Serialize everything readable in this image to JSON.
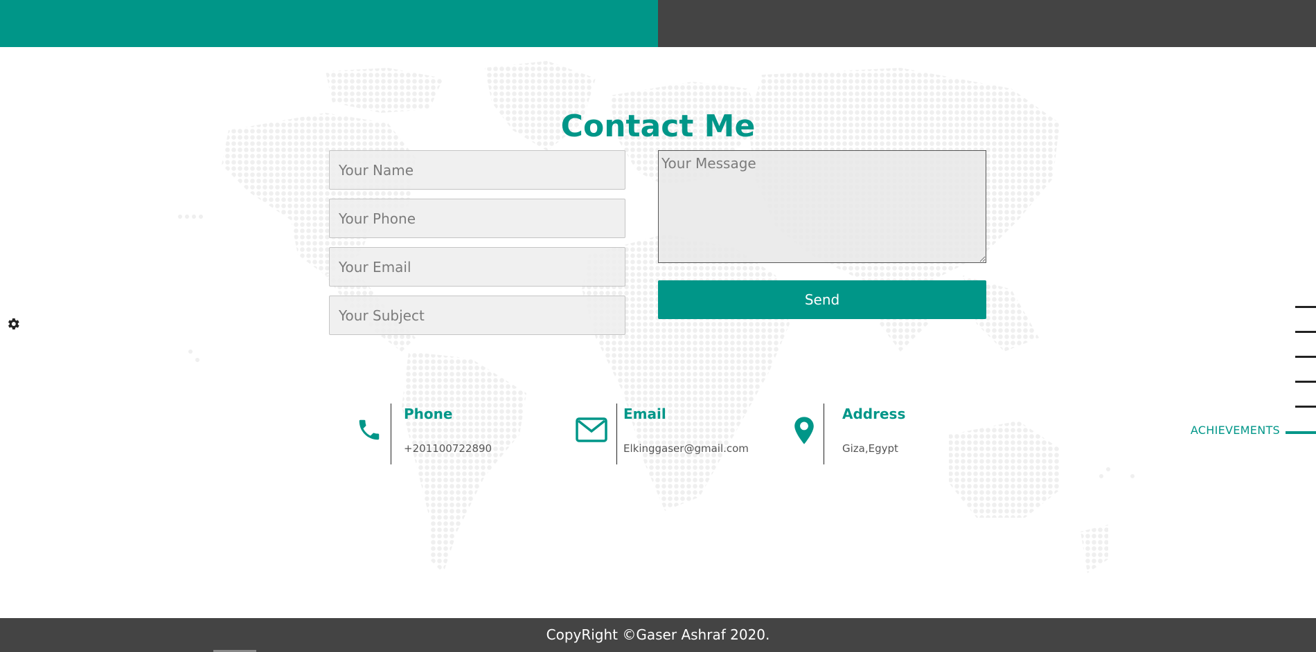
{
  "contact": {
    "title": "Contact Me",
    "form": {
      "name_placeholder": "Your Name",
      "phone_placeholder": "Your Phone",
      "email_placeholder": "Your Email",
      "subject_placeholder": "Your Subject",
      "message_placeholder": "Your Message",
      "send_label": "Send"
    },
    "info": [
      {
        "icon": "phone-icon",
        "label": "Phone",
        "value": "+201100722890"
      },
      {
        "icon": "envelope-icon",
        "label": "Email",
        "value": "Elkinggaser@gmail.com"
      },
      {
        "icon": "map-marker-icon",
        "label": "Address",
        "value": "Giza,Egypt"
      }
    ]
  },
  "side_nav": {
    "active_label": "ACHIEVEMENTS"
  },
  "footer": {
    "copyright": "CopyRight ©Gaser Ashraf 2020."
  },
  "colors": {
    "accent": "#009688",
    "dark": "#444444",
    "field_bg": "#ededed"
  }
}
